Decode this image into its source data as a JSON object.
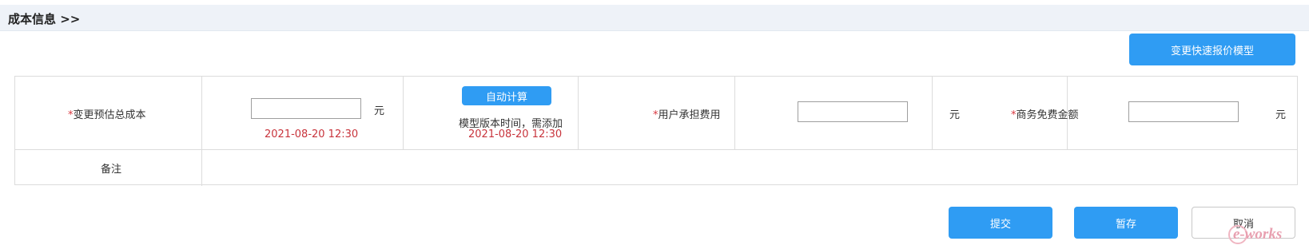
{
  "section": {
    "title": "成本信息 >>"
  },
  "toolbar": {
    "quote_model_label": "变更快速报价模型"
  },
  "form": {
    "total_cost": {
      "required_mark": "*",
      "label": "变更预估总成本",
      "value": "",
      "unit": "元",
      "date": "2021-08-20 12:30"
    },
    "auto_calc": {
      "button_label": "自动计算",
      "note": "模型版本时间，需添加",
      "date": "2021-08-20 12:30"
    },
    "user_fee": {
      "required_mark": "*",
      "label": "用户承担费用",
      "value": "",
      "unit": "元"
    },
    "free_amount": {
      "required_mark": "*",
      "label": "商务免费金额",
      "value": "",
      "unit": "元"
    },
    "remark": {
      "label": "备注",
      "value": ""
    }
  },
  "actions": {
    "submit_label": "提交",
    "draft_label": "暂存",
    "cancel_label": "取消"
  },
  "watermark": {
    "text": "e-works"
  },
  "colors": {
    "primary": "#2f9cf3",
    "required": "#d9363e",
    "date": "#c8343c",
    "header_bg": "#eef2f8"
  }
}
